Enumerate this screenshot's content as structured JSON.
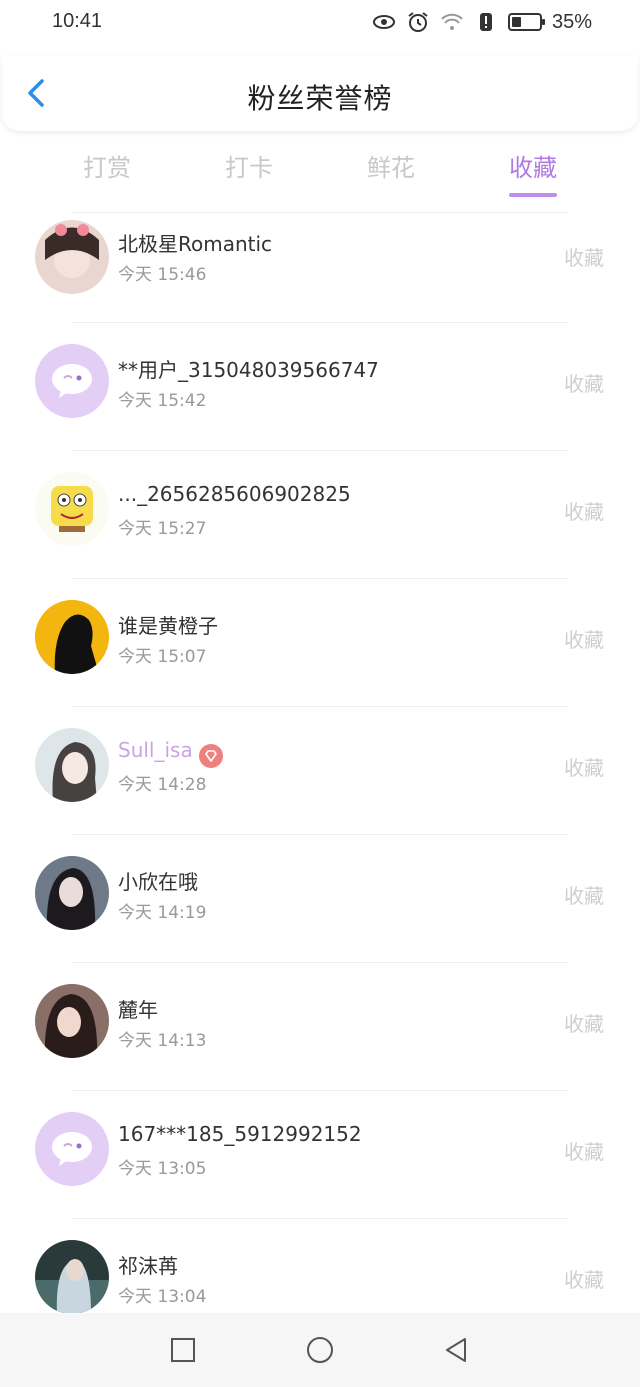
{
  "status": {
    "time": "10:41",
    "battery_text": "35%",
    "battery_level": 0.35
  },
  "header": {
    "title": "粉丝荣誉榜"
  },
  "tabs": [
    {
      "label": "打赏",
      "active": false
    },
    {
      "label": "打卡",
      "active": false
    },
    {
      "label": "鲜花",
      "active": false
    },
    {
      "label": "收藏",
      "active": true
    }
  ],
  "rows": [
    {
      "name": "北极星Romantic",
      "time": "今天 15:46",
      "action": "收藏",
      "avatar": "photo-pink"
    },
    {
      "name": "**用户_315048039566747",
      "time": "今天 15:42",
      "action": "收藏",
      "avatar": "default-chat-icon"
    },
    {
      "name": "..._2656285606902825",
      "time": "今天 15:27",
      "action": "收藏",
      "avatar": "spongebob"
    },
    {
      "name": "谁是黄橙子",
      "time": "今天 15:07",
      "action": "收藏",
      "avatar": "silhouette-yellow"
    },
    {
      "name": "Sull_isa",
      "time": "今天 14:28",
      "action": "收藏",
      "avatar": "photo-girl",
      "vip": true
    },
    {
      "name": "小欣在哦",
      "time": "今天 14:19",
      "action": "收藏",
      "avatar": "photo-dark"
    },
    {
      "name": "麓年",
      "time": "今天 14:13",
      "action": "收藏",
      "avatar": "photo-brown"
    },
    {
      "name": "167***185_5912992152",
      "time": "今天 13:05",
      "action": "收藏",
      "avatar": "default-chat-icon"
    },
    {
      "name": "祁沫苒",
      "time": "今天 13:04",
      "action": "收藏",
      "avatar": "photo-blue"
    }
  ],
  "colors": {
    "accent": "#b07be0",
    "avatar_default_bg": "#e3cff6",
    "vip_badge": "#f08080"
  }
}
